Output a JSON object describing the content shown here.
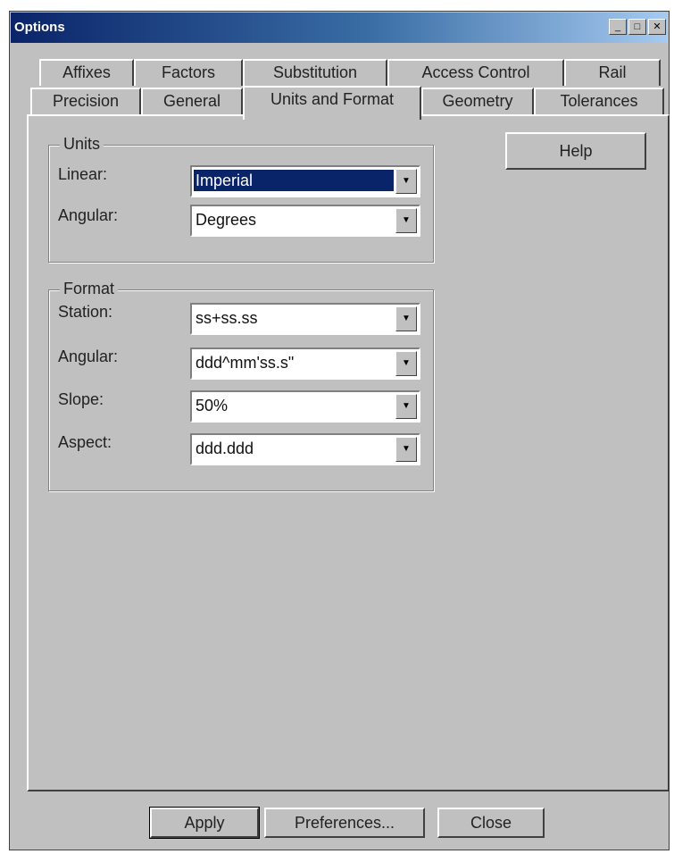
{
  "window": {
    "title": "Options"
  },
  "titlebar_buttons": {
    "minimize": "_",
    "maximize": "□",
    "close": "✕"
  },
  "tabs_row1": [
    "Affixes",
    "Factors",
    "Substitution",
    "Access Control",
    "Rail"
  ],
  "tabs_row2": [
    "Precision",
    "General",
    "Units and Format",
    "Geometry",
    "Tolerances"
  ],
  "active_tab": "Units and Format",
  "help_label": "Help",
  "units": {
    "legend": "Units",
    "linear_label": "Linear:",
    "linear_value": "Imperial",
    "angular_label": "Angular:",
    "angular_value": "Degrees"
  },
  "format": {
    "legend": "Format",
    "station_label": "Station:",
    "station_value": "ss+ss.ss",
    "angular_label": "Angular:",
    "angular_value": "ddd^mm'ss.s\"",
    "slope_label": "Slope:",
    "slope_value": "50%",
    "aspect_label": "Aspect:",
    "aspect_value": "ddd.ddd"
  },
  "footer": {
    "apply": "Apply",
    "preferences": "Preferences...",
    "close": "Close"
  }
}
